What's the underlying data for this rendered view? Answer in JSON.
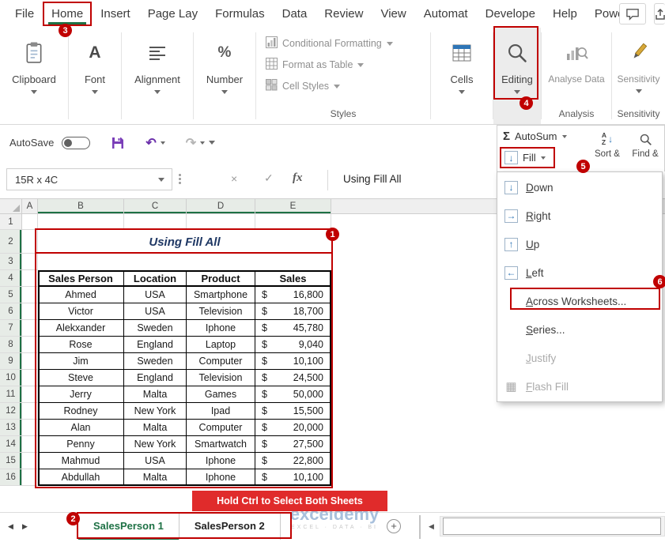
{
  "colors": {
    "annotation_red": "#C00000",
    "callout_red": "#E02B2B",
    "excel_green": "#1E7145",
    "title_navy": "#1F3864"
  },
  "tab_bar": {
    "tabs": [
      "File",
      "Home",
      "Insert",
      "Page Lay",
      "Formulas",
      "Data",
      "Review",
      "View",
      "Automat",
      "Develope",
      "Help",
      "Power Pi"
    ],
    "active_tab": "Home"
  },
  "ribbon": {
    "clipboard_label": "Clipboard",
    "font_label": "Font",
    "alignment_label": "Alignment",
    "number_label": "Number",
    "styles_items": [
      "Conditional Formatting",
      "Format as Table",
      "Cell Styles"
    ],
    "styles_caption": "Styles",
    "cells_label": "Cells",
    "editing_label": "Editing",
    "analyse_data_label": "Analyse Data",
    "analysis_caption": "Analysis",
    "sensitivity_label": "Sensitivity",
    "sensitivity_caption": "Sensitivity"
  },
  "qat": {
    "autosave_label": "AutoSave"
  },
  "editing_flyout": {
    "autosum_label": "AutoSum",
    "fill_label": "Fill",
    "sort_label": "Sort &",
    "find_label": "Find &"
  },
  "fill_menu": {
    "items": [
      {
        "accel": "D",
        "rest": "own",
        "icon": "down",
        "disabled": false,
        "highlighted": false
      },
      {
        "accel": "R",
        "rest": "ight",
        "icon": "right",
        "disabled": false,
        "highlighted": false
      },
      {
        "accel": "U",
        "rest": "p",
        "icon": "up",
        "disabled": false,
        "highlighted": false
      },
      {
        "accel": "L",
        "rest": "eft",
        "icon": "left",
        "disabled": false,
        "highlighted": false
      },
      {
        "accel": "A",
        "rest": "cross Worksheets...",
        "icon": "",
        "disabled": false,
        "highlighted": true
      },
      {
        "accel": "S",
        "rest": "eries...",
        "icon": "",
        "disabled": false,
        "highlighted": false
      },
      {
        "accel": "J",
        "rest": "ustify",
        "icon": "",
        "disabled": true,
        "highlighted": false
      },
      {
        "accel": "F",
        "rest": "lash Fill",
        "icon": "flash",
        "disabled": true,
        "highlighted": false
      }
    ]
  },
  "formula_bar": {
    "name_box": "15R x 4C",
    "formula": "Using Fill All"
  },
  "sheet": {
    "columns": [
      "A",
      "B",
      "C",
      "D",
      "E"
    ],
    "selected_columns": [
      "B",
      "C",
      "D",
      "E"
    ],
    "row_count": 16,
    "title": "Using Fill All",
    "table": {
      "headers": [
        "Sales Person",
        "Location",
        "Product",
        "Sales"
      ],
      "currency_symbol": "$",
      "rows": [
        [
          "Ahmed",
          "USA",
          "Smartphone",
          "16,800"
        ],
        [
          "Victor",
          "USA",
          "Television",
          "18,700"
        ],
        [
          "Alekxander",
          "Sweden",
          "Iphone",
          "45,780"
        ],
        [
          "Rose",
          "England",
          "Laptop",
          "9,040"
        ],
        [
          "Jim",
          "Sweden",
          "Computer",
          "10,100"
        ],
        [
          "Steve",
          "England",
          "Television",
          "24,500"
        ],
        [
          "Jerry",
          "Malta",
          "Games",
          "50,000"
        ],
        [
          "Rodney",
          "New York",
          "Ipad",
          "15,500"
        ],
        [
          "Alan",
          "Malta",
          "Computer",
          "20,000"
        ],
        [
          "Penny",
          "New York",
          "Smartwatch",
          "27,500"
        ],
        [
          "Mahmud",
          "USA",
          "Iphone",
          "22,800"
        ],
        [
          "Abdullah",
          "Malta",
          "Iphone",
          "10,100"
        ]
      ]
    }
  },
  "sheet_tabs": [
    {
      "label": "SalesPerson 1",
      "active": true
    },
    {
      "label": "SalesPerson 2",
      "active": false
    }
  ],
  "callout": {
    "text": "Hold Ctrl to Select Both Sheets"
  },
  "watermark": {
    "title": "exceldemy",
    "subtitle": "EXCEL · DATA · BI"
  },
  "annotations": {
    "numbers": [
      "1",
      "2",
      "3",
      "4",
      "5",
      "6"
    ]
  }
}
